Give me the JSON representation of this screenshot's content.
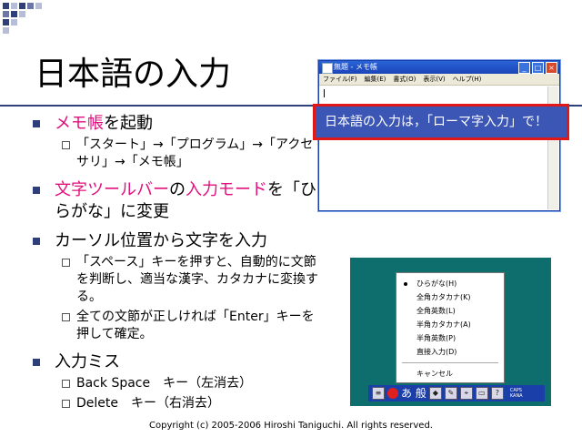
{
  "slide": {
    "title": "日本語の入力",
    "footer": "Copyright (c) 2005-2006 Hiroshi Taniguchi. All rights reserved."
  },
  "bullets": {
    "b1_hl": "メモ帳",
    "b1_rest": "を起動",
    "b1_sub1": "「スタート」→「プログラム」→「アクセサリ」→「メモ帳」",
    "b2_hl1": "文字ツールバー",
    "b2_mid1": "の",
    "b2_hl2": "入力モード",
    "b2_rest": "を「ひらがな」に変更",
    "b3": "カーソル位置から文字を入力",
    "b3_sub1": "「スペース」キーを押すと、自動的に文節を判断し、適当な漢字、カタカナに変換する。",
    "b3_sub2": "全ての文節が正しければ「Enter」キーを押して確定。",
    "b4": "入力ミス",
    "b4_sub1": "Back Space　キー（左消去）",
    "b4_sub2": "Delete　キー（右消去）"
  },
  "notepad": {
    "title": "無題 - メモ帳",
    "menus": [
      "ファイル(F)",
      "編集(E)",
      "書式(O)",
      "表示(V)",
      "ヘルプ(H)"
    ]
  },
  "callout": {
    "text": "日本語の入力は，「ローマ字入力」で！"
  },
  "ime": {
    "menu_items": [
      "ひらがな(H)",
      "全角カタカナ(K)",
      "全角英数(L)",
      "半角カタカナ(A)",
      "半角英数(P)",
      "直接入力(D)"
    ],
    "cancel": "キャンセル",
    "mode_label": "あ 般",
    "caps": "CAPS",
    "kana": "KANA"
  },
  "colors": {
    "accent": "#2e3f7a",
    "highlight": "#e0107c",
    "callout_bg": "#3b56b4",
    "callout_border": "#e01818",
    "ime_bg": "#0e6e6e"
  }
}
